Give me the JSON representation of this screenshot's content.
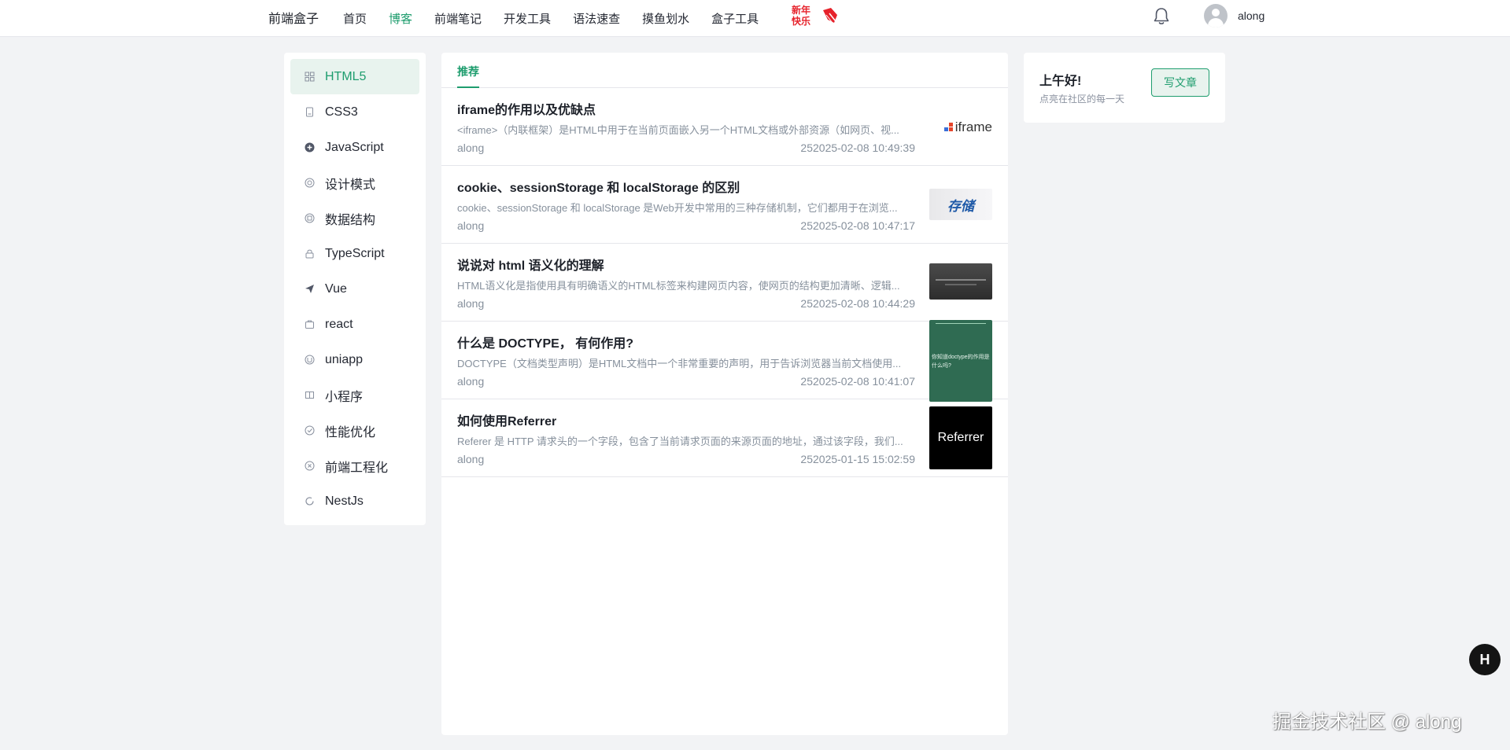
{
  "header": {
    "brand": "前端盒子",
    "nav": [
      {
        "label": "首页",
        "active": false
      },
      {
        "label": "博客",
        "active": true
      },
      {
        "label": "前端笔记",
        "active": false
      },
      {
        "label": "开发工具",
        "active": false
      },
      {
        "label": "语法速查",
        "active": false
      },
      {
        "label": "摸鱼划水",
        "active": false
      },
      {
        "label": "盒子工具",
        "active": false
      }
    ],
    "festival_text": "新年快乐",
    "user_name": "along"
  },
  "sidebar": {
    "items": [
      {
        "label": "HTML5",
        "icon": "grid-icon",
        "active": true
      },
      {
        "label": "CSS3",
        "icon": "file-icon",
        "active": false
      },
      {
        "label": "JavaScript",
        "icon": "plus-circle-icon",
        "active": false
      },
      {
        "label": "设计模式",
        "icon": "target-icon",
        "active": false
      },
      {
        "label": "数据结构",
        "icon": "layers-icon",
        "active": false
      },
      {
        "label": "TypeScript",
        "icon": "lock-icon",
        "active": false
      },
      {
        "label": "Vue",
        "icon": "send-icon",
        "active": false
      },
      {
        "label": "react",
        "icon": "briefcase-icon",
        "active": false
      },
      {
        "label": "uniapp",
        "icon": "mobile-icon",
        "active": false
      },
      {
        "label": "小程序",
        "icon": "book-icon",
        "active": false
      },
      {
        "label": "性能优化",
        "icon": "check-circle-icon",
        "active": false
      },
      {
        "label": "前端工程化",
        "icon": "settings-circle-icon",
        "active": false
      },
      {
        "label": "NestJs",
        "icon": "loop-icon",
        "active": false
      }
    ]
  },
  "main": {
    "tab": "推荐",
    "articles": [
      {
        "title": "iframe的作用以及优缺点",
        "desc": "<iframe>（内联框架）是HTML中用于在当前页面嵌入另一个HTML文档或外部资源（如网页、视...",
        "author": "along",
        "time": "252025-02-08 10:49:39",
        "thumb": "iframe"
      },
      {
        "title": "cookie、sessionStorage 和 localStorage 的区别",
        "desc": "cookie、sessionStorage 和 localStorage 是Web开发中常用的三种存储机制，它们都用于在浏览...",
        "author": "along",
        "time": "252025-02-08 10:47:17",
        "thumb": "存储"
      },
      {
        "title": "说说对 html 语义化的理解",
        "desc": "HTML语义化是指使用具有明确语义的HTML标签来构建网页内容，使网页的结构更加清晰、逻辑...",
        "author": "along",
        "time": "252025-02-08 10:44:29",
        "thumb": ""
      },
      {
        "title": "什么是 DOCTYPE， 有何作用?",
        "desc": "DOCTYPE（文档类型声明）是HTML文档中一个非常重要的声明，用于告诉浏览器当前文档使用...",
        "author": "along",
        "time": "252025-02-08 10:41:07",
        "thumb": "你知道doctype的作用是什么吗?"
      },
      {
        "title": "如何使用Referrer",
        "desc": "Referer 是 HTTP 请求头的一个字段，包含了当前请求页面的来源页面的地址，通过该字段，我们...",
        "author": "along",
        "time": "252025-01-15 15:02:59",
        "thumb": "Referrer"
      }
    ]
  },
  "greet": {
    "title": "上午好!",
    "subtitle": "点亮在社区的每一天",
    "button": "写文章"
  },
  "watermark": "掘金技术社区 @ along",
  "colors": {
    "accent": "#1e9d6e",
    "background": "#f2f3f5"
  }
}
